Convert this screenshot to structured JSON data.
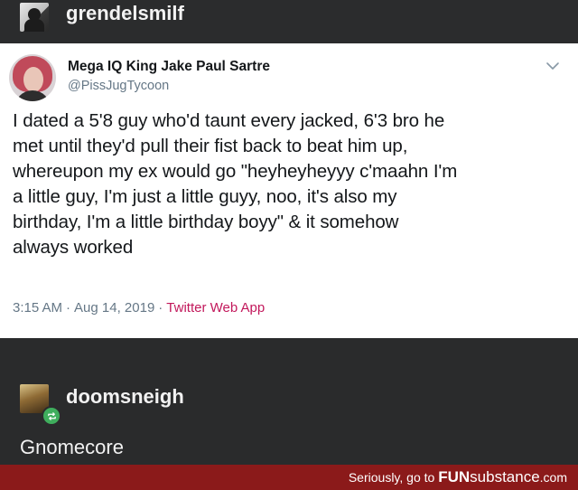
{
  "original_post": {
    "username": "grendelsmilf"
  },
  "tweet": {
    "display_name": "Mega IQ King Jake Paul Sartre",
    "handle": "@PissJugTycoon",
    "text": "I dated a 5'8 guy who'd taunt every jacked, 6'3 bro he\nmet until they'd pull their fist back to beat him up,\nwhereupon my ex would go \"heyheyheyyy c'maahn I'm\na little guy, I'm just a little guyy, noo, it's also my\nbirthday, I'm a little birthday boyy\" & it somehow\nalways worked",
    "time": "3:15 AM",
    "date": "Aug 14, 2019",
    "separator": "·",
    "via": "Twitter Web App",
    "menu_icon": "chevron-down-icon"
  },
  "reblog": {
    "username": "doomsneigh",
    "comment": "Gnomecore",
    "badge_icon": "reblog-icon",
    "badge_color": "#3fae5d"
  },
  "footer": {
    "prefix": "Seriously, go to ",
    "brand_bold": "FUN",
    "brand_light": "substance",
    "suffix": ".com",
    "background": "#8b1a1a"
  },
  "colors": {
    "background": "#2a2b2c",
    "card": "#ffffff",
    "tweet_source": "#c2185b"
  }
}
